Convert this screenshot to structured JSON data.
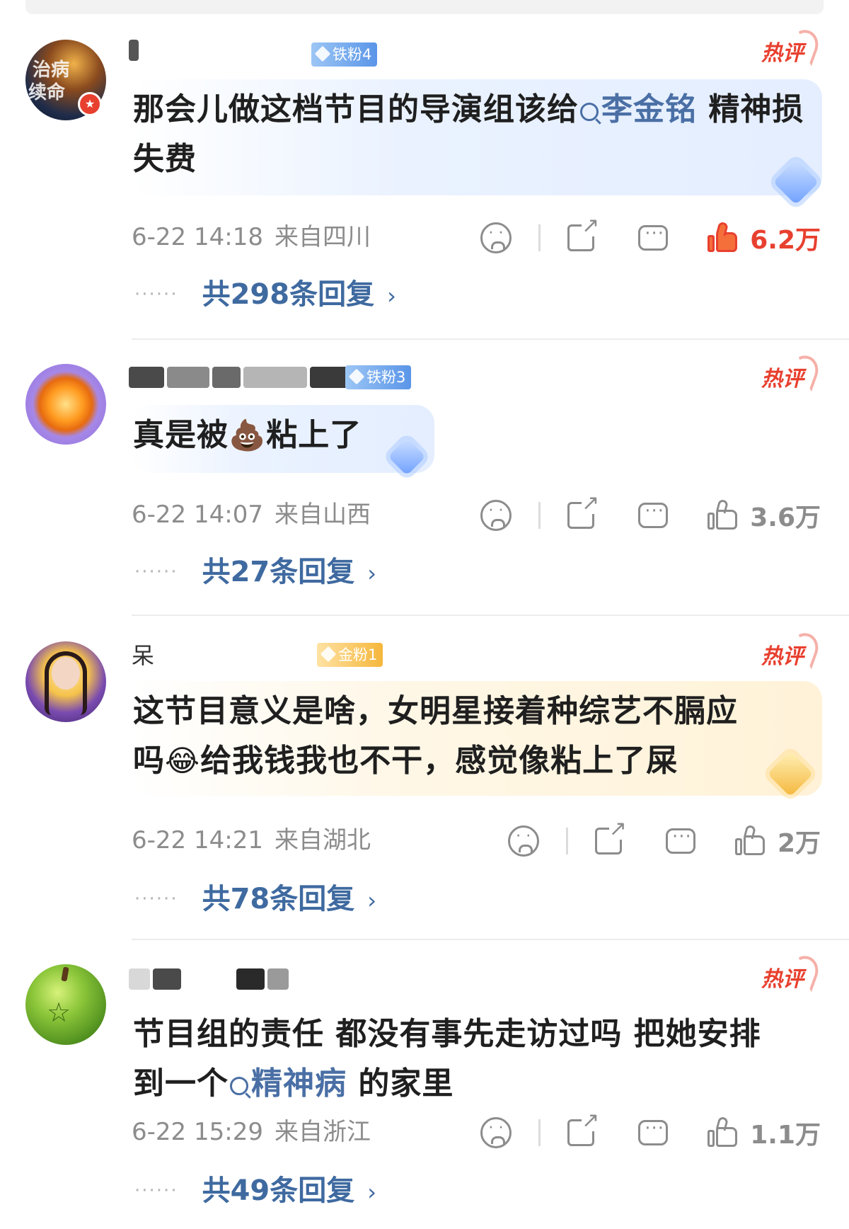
{
  "comments": [
    {
      "username": "",
      "fan_badge": "铁粉4",
      "hot_label": "热评",
      "text_parts": [
        "那会儿做这档节目的导演组该给",
        "李金铭",
        " 精神损失费"
      ],
      "time": "6-22 14:18",
      "location": "来自四川",
      "likes": "6.2万",
      "replies": "共298条回复"
    },
    {
      "username": "",
      "fan_badge": "铁粉3",
      "hot_label": "热评",
      "text_before": "真是被",
      "emoji": "💩",
      "text_after": "粘上了",
      "time": "6-22 14:07",
      "location": "来自山西",
      "likes": "3.6万",
      "replies": "共27条回复"
    },
    {
      "username": "呆",
      "fan_badge": "金粉1",
      "hot_label": "热评",
      "text_line1": "这节目意义是啥，女明星接着种综艺不膈应",
      "text_line2_before": "吗",
      "emoji": "😂",
      "text_line2_after": "给我钱我也不干，感觉像粘上了屎",
      "time": "6-22 14:21",
      "location": "来自湖北",
      "likes": "2万",
      "replies": "共78条回复"
    },
    {
      "username": "",
      "hot_label": "热评",
      "text_line1": "节目组的责任 都没有事先走访过吗 把她安排",
      "text_line2_before": "到一个",
      "link": "精神病",
      "text_line2_after": " 的家里",
      "time": "6-22 15:29",
      "location": "来自浙江",
      "likes": "1.1万",
      "replies": "共49条回复"
    }
  ],
  "colors": {
    "link": "#4a6fa5",
    "hot": "#e8402f",
    "meta": "#8c8c8c",
    "replies": "#3f6aa0"
  },
  "icons": [
    "sad-face-icon",
    "share-icon",
    "comment-icon",
    "thumbs-up-icon",
    "chevron-right-icon",
    "search-icon",
    "hot-flame-icon",
    "diamond-gem-icon"
  ]
}
